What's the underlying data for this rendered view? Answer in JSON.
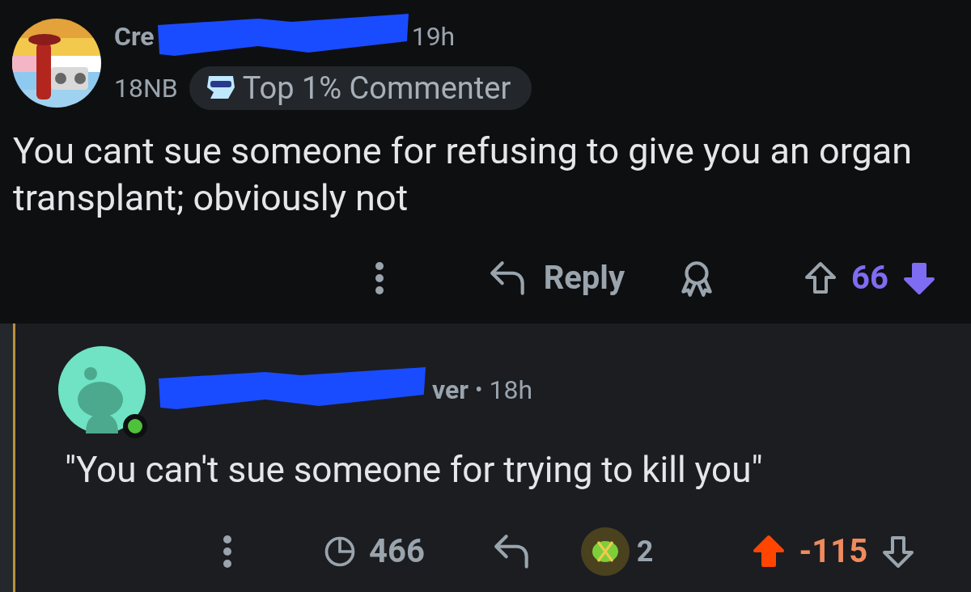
{
  "comments": [
    {
      "author": "Cre",
      "time": "19h",
      "flair": "18NB",
      "badge": {
        "label": "Top 1% Commenter"
      },
      "text": "You cant sue someone for refusing to give you an organ transplant; obviously not",
      "actions": {
        "reply": "Reply",
        "score": "66",
        "upvoted": false,
        "downvoted": true
      }
    },
    {
      "author": "ver",
      "separator": "•",
      "time": "18h",
      "online": true,
      "text": "\"You can't sue someone for trying to kill you\"",
      "actions": {
        "views": "466",
        "award_count": "2",
        "score": "-115",
        "upvoted": true,
        "downvoted": false
      }
    }
  ]
}
